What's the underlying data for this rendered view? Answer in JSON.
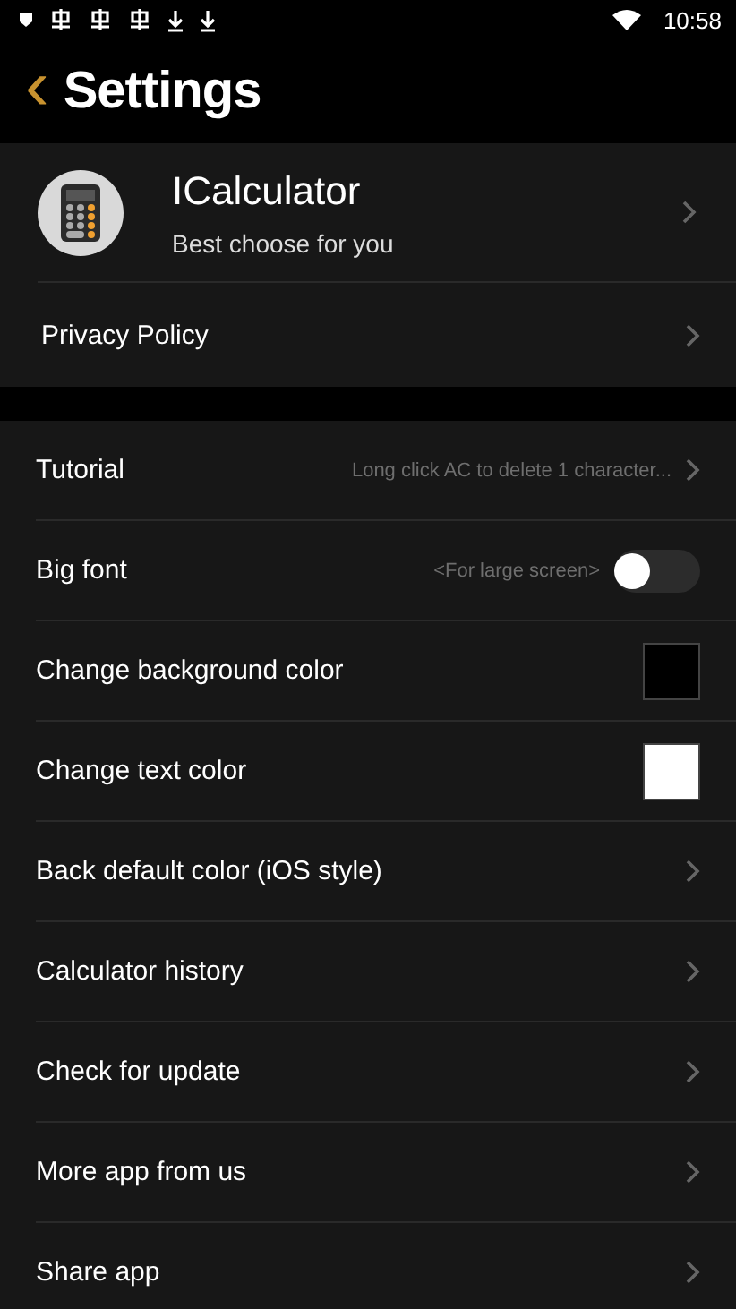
{
  "status_bar": {
    "time": "10:58"
  },
  "header": {
    "back": "‹",
    "title": "Settings"
  },
  "profile": {
    "name": "ICalculator",
    "tagline": "Best choose for you"
  },
  "links": [
    {
      "label": "Privacy Policy"
    }
  ],
  "settings": [
    {
      "kind": "chevron",
      "label": "Tutorial",
      "hint": "Long click AC to delete 1 character..."
    },
    {
      "kind": "toggle",
      "label": "Big font",
      "hint": "<For large screen>",
      "on": false
    },
    {
      "kind": "swatch",
      "label": "Change background color",
      "color": "#000000"
    },
    {
      "kind": "swatch",
      "label": "Change text color",
      "color": "#ffffff"
    },
    {
      "kind": "chevron",
      "label": "Back default color (iOS style)"
    },
    {
      "kind": "chevron",
      "label": "Calculator history"
    },
    {
      "kind": "chevron",
      "label": "Check for update"
    },
    {
      "kind": "chevron",
      "label": "More app from us"
    },
    {
      "kind": "chevron",
      "label": "Share app"
    }
  ]
}
